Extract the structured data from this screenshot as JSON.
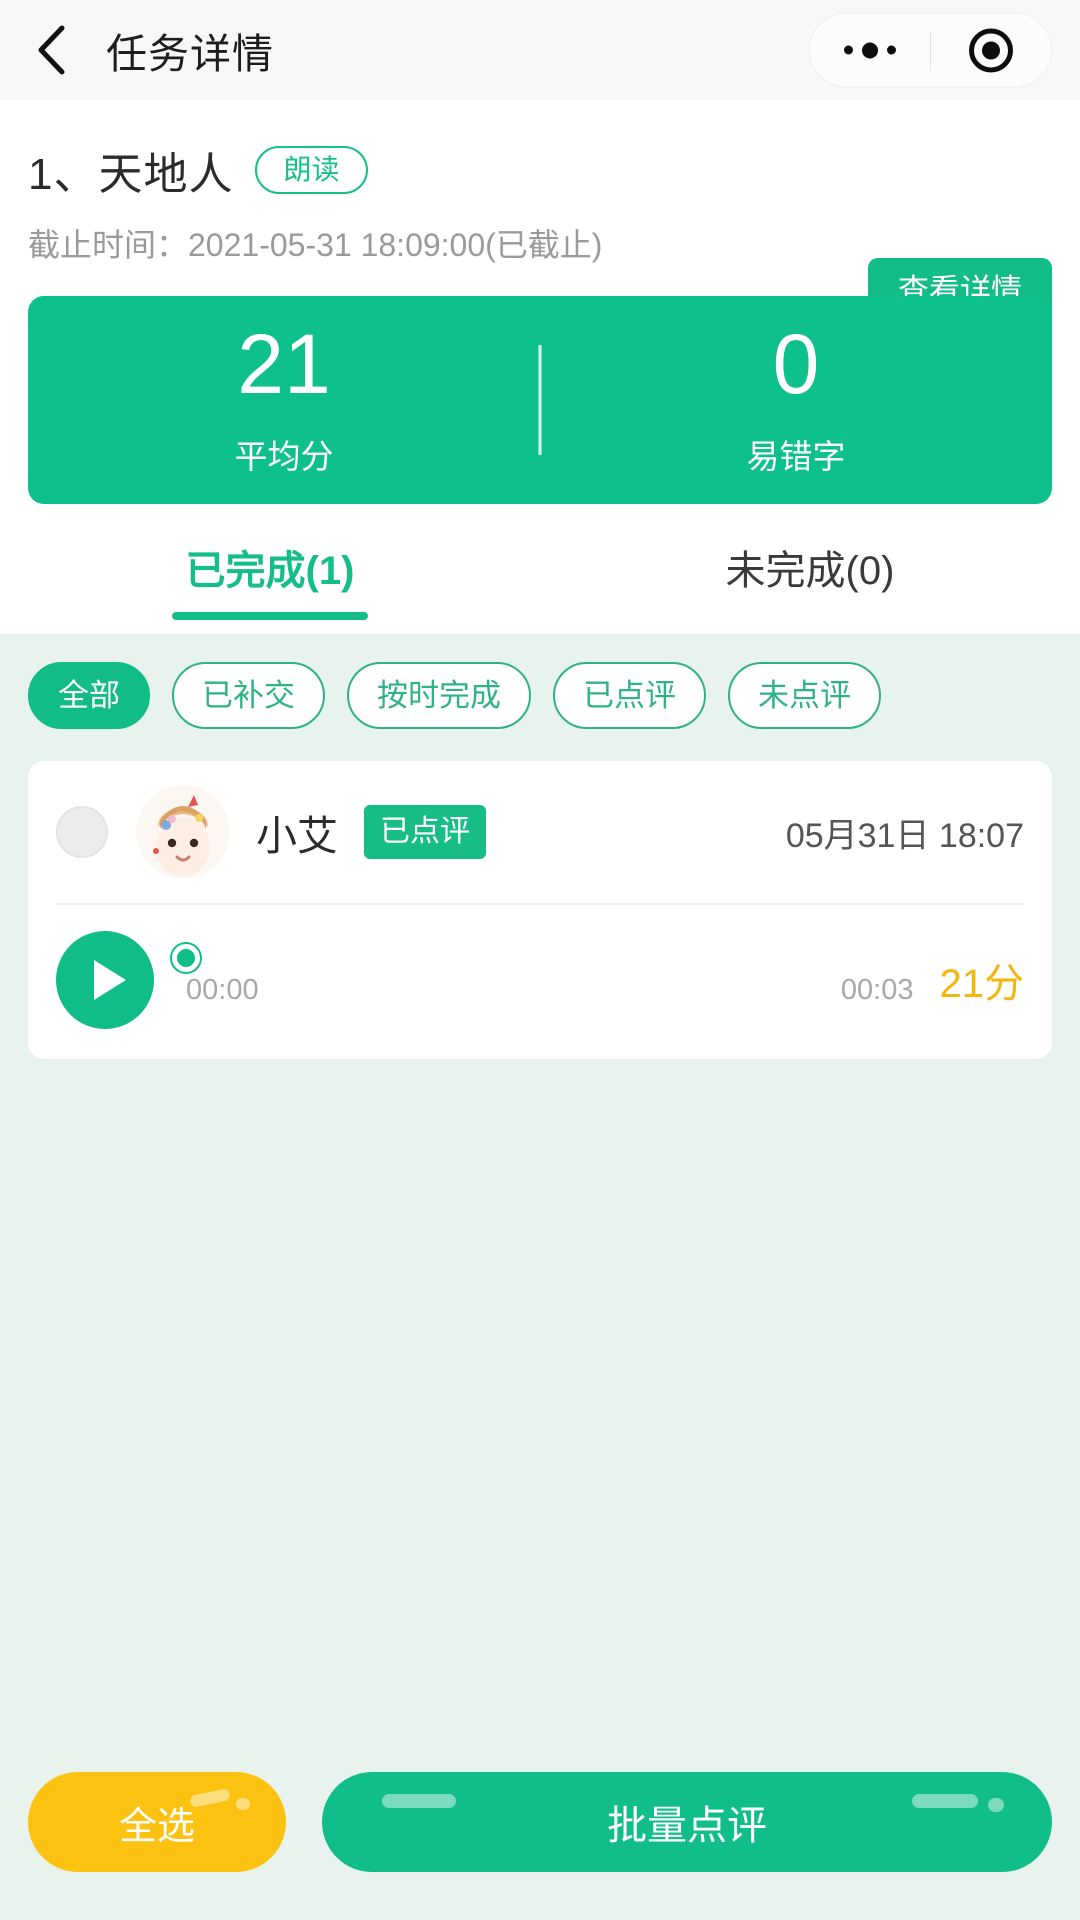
{
  "navbar": {
    "back_icon": "chevron-left-icon",
    "title": "任务详情",
    "capsule": {
      "more_icon": "more-dots-icon",
      "target_icon": "target-circle-icon"
    }
  },
  "task": {
    "title": "1、天地人",
    "tag": "朗读",
    "deadline": "截止时间：2021-05-31 18:09:00(已截止)",
    "detail_button": "查看详情"
  },
  "stats": [
    {
      "value": "21",
      "label": "平均分"
    },
    {
      "value": "0",
      "label": "易错字"
    }
  ],
  "tabs": [
    {
      "label": "已完成(1)",
      "active": true
    },
    {
      "label": "未完成(0)",
      "active": false
    }
  ],
  "filters": [
    {
      "label": "全部",
      "active": true
    },
    {
      "label": "已补交",
      "active": false
    },
    {
      "label": "按时完成",
      "active": false
    },
    {
      "label": "已点评",
      "active": false
    },
    {
      "label": "未点评",
      "active": false
    }
  ],
  "submission": {
    "student_name": "小艾",
    "status_badge": "已点评",
    "submit_time": "05月31日 18:07",
    "player": {
      "current_time": "00:00",
      "total_time": "00:03",
      "progress_percent": 0
    },
    "score": "21分"
  },
  "bottom": {
    "select_all": "全选",
    "batch_review": "批量点评"
  },
  "colors": {
    "brand_green": "#0ec18c",
    "accent_yellow": "#fcc211",
    "score_orange": "#f2b60c",
    "page_bg": "#e9f3ee"
  }
}
